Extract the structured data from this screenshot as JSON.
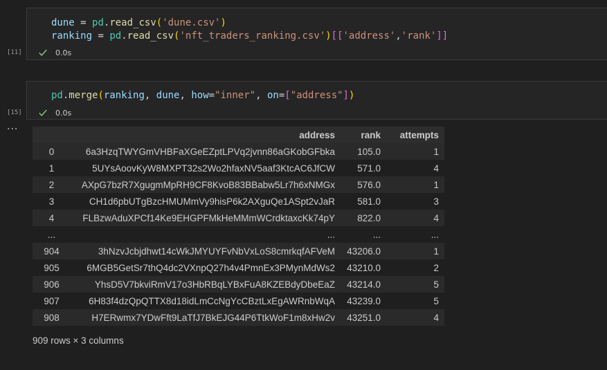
{
  "cells": [
    {
      "exec_count": "[11]",
      "exec_time": "0.0s",
      "code": {
        "l1_var": "dune",
        "l1_eq": " = ",
        "l1_mod": "pd",
        "l1_dot": ".",
        "l1_fn": "read_csv",
        "l1_open": "(",
        "l1_str": "'dune.csv'",
        "l1_close": ")",
        "l2_var": "ranking",
        "l2_eq": " = ",
        "l2_mod": "pd",
        "l2_dot": ".",
        "l2_fn": "read_csv",
        "l2_open": "(",
        "l2_str": "'nft_traders_ranking.csv'",
        "l2_close": ")",
        "l2_b_open": "[[",
        "l2_s1": "'address'",
        "l2_comma": ",",
        "l2_s2": "'rank'",
        "l2_b_close": "]]"
      }
    },
    {
      "exec_count": "[15]",
      "exec_time": "0.0s",
      "code": {
        "mod": "pd",
        "dot": ".",
        "fn": "merge",
        "open": "(",
        "a1": "ranking",
        "c1": ", ",
        "a2": "dune",
        "c2": ", ",
        "k1": "how",
        "eq1": "=",
        "s1": "\"inner\"",
        "c3": ", ",
        "k2": "on",
        "eq2": "=",
        "bo": "[",
        "s2": "\"address\"",
        "bc": "]",
        "close": ")"
      }
    }
  ],
  "more_label": "···",
  "table": {
    "columns": [
      "",
      "address",
      "rank",
      "attempts"
    ],
    "rows": [
      [
        "0",
        "6a3HzqTWYGmVHBFaXGeEZptLPVq2jvnn86aGKobGFbka",
        "105.0",
        "1"
      ],
      [
        "1",
        "5UYsAoovKyW8MXPT32s2Wo2hfaxNV5aaf3KtcAC6JfCW",
        "571.0",
        "4"
      ],
      [
        "2",
        "AXpG7bzR7XgugmMpRH9CF8KvoB83BBabw5Lr7h6xNMGx",
        "576.0",
        "1"
      ],
      [
        "3",
        "CH1d6pbUTgBzcHMUMmVy9hisP6k2AXguQe1ASpt2vJaR",
        "581.0",
        "3"
      ],
      [
        "4",
        "FLBzwAduXPCf14Ke9EHGPFMkHeMMmWCrdktaxcKk74pY",
        "822.0",
        "4"
      ],
      [
        "...",
        "...",
        "...",
        "..."
      ],
      [
        "904",
        "3hNzvJcbjdhwt14cWkJMYUYFvNbVxLoS8cmrkqfAFVeM",
        "43206.0",
        "1"
      ],
      [
        "905",
        "6MGB5GetSr7thQ4dc2VXnpQ27h4v4PmnEx3PMynMdWs2",
        "43210.0",
        "2"
      ],
      [
        "906",
        "YhsD5V7bkviRmV17o3HbRBqLYBxFuA8KZEBdyDbeEaZ",
        "43214.0",
        "5"
      ],
      [
        "907",
        "6H83f4dzQpQTTX8d18idLmCcNgYcCBztLxEgAWRnbWqA",
        "43239.0",
        "5"
      ],
      [
        "908",
        "H7ERwmx7YDwFft9LaTfJ7BkEJG44P6TtkWoF1m8xHw2v",
        "43251.0",
        "4"
      ]
    ]
  },
  "shape_text": "909 rows × 3 columns",
  "colors": {
    "background": "#1f1f1f",
    "cell_background": "#252526",
    "success_check": "#89d185"
  }
}
